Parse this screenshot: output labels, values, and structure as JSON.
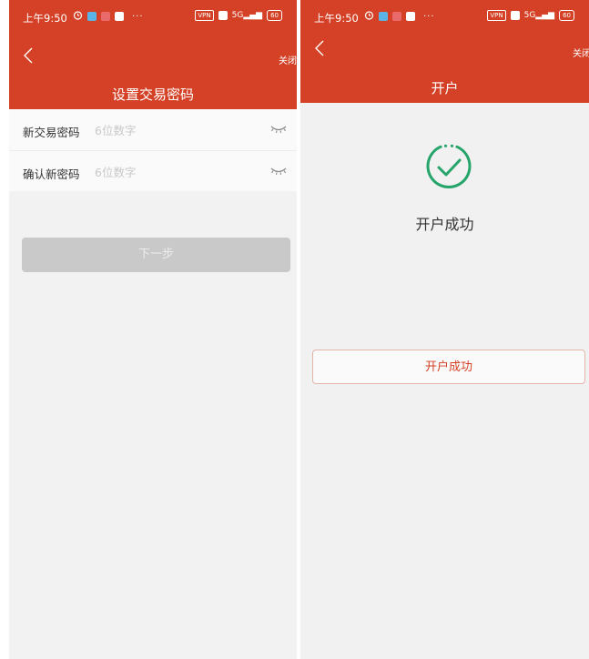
{
  "left_screen": {
    "status_bar": {
      "time": "上午9:50",
      "more": "···",
      "vpn": "VPN",
      "network": "5G",
      "battery": "60"
    },
    "nav": {
      "close_label": "关闭",
      "title": "设置交易密码"
    },
    "form": [
      {
        "label": "新交易密码",
        "placeholder": "6位数字"
      },
      {
        "label": "确认新密码",
        "placeholder": "6位数字"
      }
    ],
    "next_button": "下一步"
  },
  "right_screen": {
    "status_bar": {
      "time": "上午9:50",
      "more": "···",
      "vpn": "VPN",
      "network": "5G",
      "battery": "60"
    },
    "nav": {
      "close_label": "关闭",
      "title": "开户"
    },
    "success_message": "开户成功",
    "confirm_button": "开户成功"
  },
  "colors": {
    "header": "#d44126",
    "accent": "#d44126",
    "success": "#25a56a",
    "disabled_button": "#c9c9c9"
  },
  "icons": [
    "back-arrow-icon",
    "alarm-clock-icon",
    "eye-closed-icon",
    "success-check-icon",
    "battery-icon",
    "signal-icon"
  ]
}
